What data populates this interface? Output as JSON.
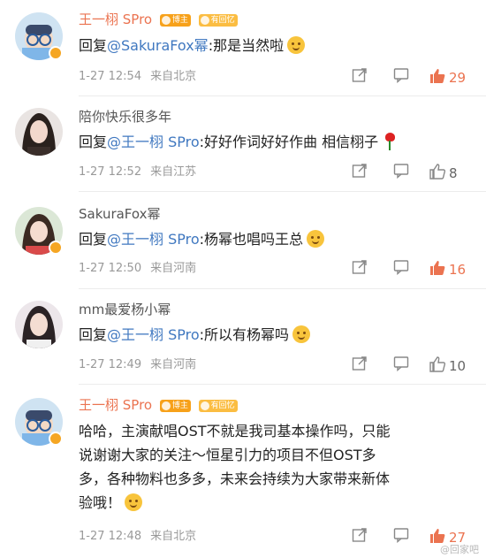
{
  "colors": {
    "accent": "#eb7350",
    "mention": "#4078c0",
    "meta": "#999999"
  },
  "comments": [
    {
      "author": "王一栩 SPro",
      "badges": [
        "博主",
        "有回忆"
      ],
      "reply_prefix": "回复",
      "mention": "@SakuraFox幂",
      "text": ":那是当然啦",
      "emoji": "smile-emoji",
      "time": "1-27 12:54",
      "source": "来自北京",
      "likes": "29",
      "liked": true
    },
    {
      "author": "陪你快乐很多年",
      "badges": [],
      "reply_prefix": "回复",
      "mention": "@王一栩 SPro",
      "text": ":好好作词好好作曲 相信栩子",
      "emoji": "rose-emoji",
      "time": "1-27 12:52",
      "source": "来自江苏",
      "likes": "8",
      "liked": false
    },
    {
      "author": "SakuraFox幂",
      "badges": [],
      "reply_prefix": "回复",
      "mention": "@王一栩 SPro",
      "text": ":杨幂也唱吗王总",
      "emoji": "surprised-emoji",
      "time": "1-27 12:50",
      "source": "来自河南",
      "likes": "16",
      "liked": true
    },
    {
      "author": "mm最爱杨小幂",
      "badges": [],
      "reply_prefix": "回复",
      "mention": "@王一栩 SPro",
      "text": ":所以有杨幂吗",
      "emoji": "wink-emoji",
      "time": "1-27 12:49",
      "source": "来自河南",
      "likes": "10",
      "liked": false
    },
    {
      "author": "王一栩 SPro",
      "badges": [
        "博主",
        "有回忆"
      ],
      "reply_prefix": "",
      "mention": "",
      "text_lines": [
        "哈哈，主演献唱OST不就是我司基本操作吗，只能",
        "说谢谢大家的关注～恒星引力的项目不但OST多",
        "多，各种物料也多多，未来会持续为大家带来新体",
        "验哦！"
      ],
      "emoji": "smile-emoji",
      "time": "1-27 12:48",
      "source": "来自北京",
      "likes": "27",
      "liked": true
    }
  ],
  "watermark": "@回家吧"
}
